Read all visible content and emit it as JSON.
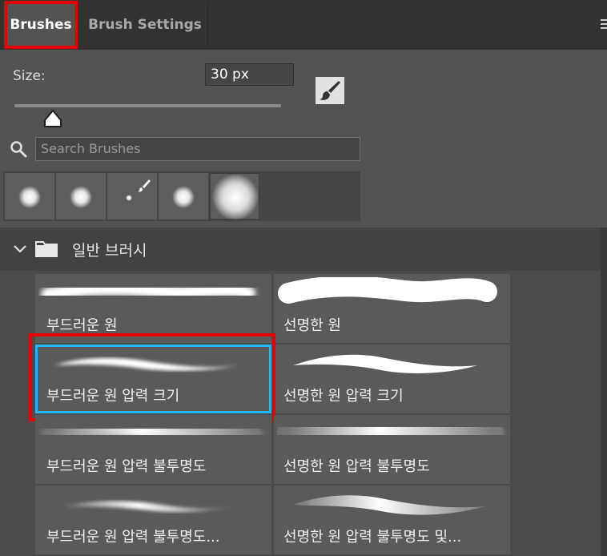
{
  "tabs": [
    {
      "label": "Brushes",
      "active": true
    },
    {
      "label": "Brush Settings",
      "active": false
    }
  ],
  "size": {
    "label": "Size:",
    "value": "30 px",
    "slider_fraction": 0.1
  },
  "search": {
    "placeholder": "Search Brushes"
  },
  "recent_brushes": [
    "soft-round-icon",
    "soft-round-icon",
    "brush-tip-icon",
    "soft-round-icon",
    "soft-round-large-icon"
  ],
  "group": {
    "name": "일반 브러시",
    "expanded": true
  },
  "brushes": [
    {
      "label": "부드러운 원"
    },
    {
      "label": "선명한 원"
    },
    {
      "label": "부드러운 원 압력 크기",
      "selected": true
    },
    {
      "label": "선명한 원 압력 크기"
    },
    {
      "label": "부드러운 원 압력 불투명도"
    },
    {
      "label": "선명한 원 압력 불투명도"
    },
    {
      "label": "부드러운 원 압력 불투명도..."
    },
    {
      "label": "선명한 원 압력 불투명도 및..."
    }
  ],
  "colors": {
    "highlight": "#e60000",
    "selection": "#26b7f0",
    "panel": "#535353"
  }
}
